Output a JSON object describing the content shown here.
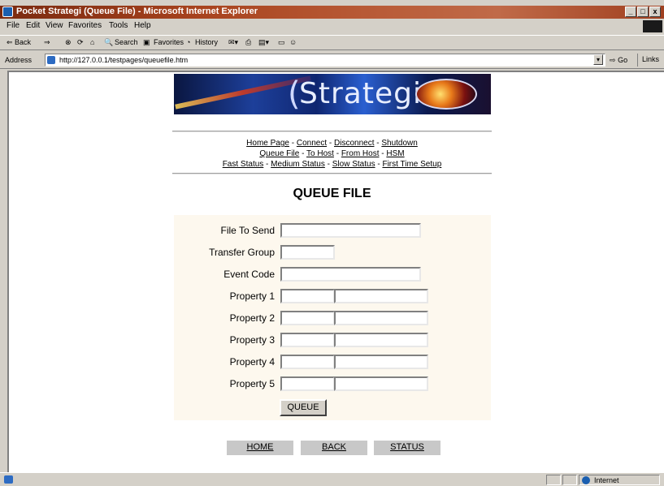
{
  "window": {
    "title": "Pocket Strategi (Queue File) - Microsoft Internet Explorer",
    "controls": [
      "_",
      "□",
      "x"
    ]
  },
  "menu": [
    "File",
    "Edit",
    "View",
    "Favorites",
    "Tools",
    "Help"
  ],
  "toolbar": {
    "back": "⇐ Back",
    "forward": "⇒",
    "search": "Search",
    "favorites": "Favorites",
    "history": "History"
  },
  "address": {
    "label": "Address",
    "url": "http://127.0.0.1/testpages/queuefile.htm",
    "go": "Go",
    "links": "Links"
  },
  "banner": {
    "logo_text": "Strategi"
  },
  "nav": {
    "row1": [
      "Home Page",
      "Connect",
      "Disconnect",
      "Shutdown"
    ],
    "row2": [
      "Queue File",
      "To Host",
      "From Host",
      "HSM"
    ],
    "row3": [
      "Fast Status",
      "Medium Status",
      "Slow Status",
      "First Time Setup"
    ],
    "separator": " - "
  },
  "page_title": "QUEUE FILE",
  "form": {
    "file_to_send": {
      "label": "File To Send",
      "value": ""
    },
    "transfer_group": {
      "label": "Transfer Group",
      "value": ""
    },
    "event_code": {
      "label": "Event Code",
      "value": ""
    },
    "properties": [
      {
        "label": "Property 1",
        "name": "",
        "value": ""
      },
      {
        "label": "Property 2",
        "name": "",
        "value": ""
      },
      {
        "label": "Property 3",
        "name": "",
        "value": ""
      },
      {
        "label": "Property 4",
        "name": "",
        "value": ""
      },
      {
        "label": "Property 5",
        "name": "",
        "value": ""
      }
    ],
    "submit_label": "QUEUE"
  },
  "bottom_buttons": [
    "HOME",
    "BACK",
    "STATUS"
  ],
  "status": {
    "zone": "Internet"
  }
}
